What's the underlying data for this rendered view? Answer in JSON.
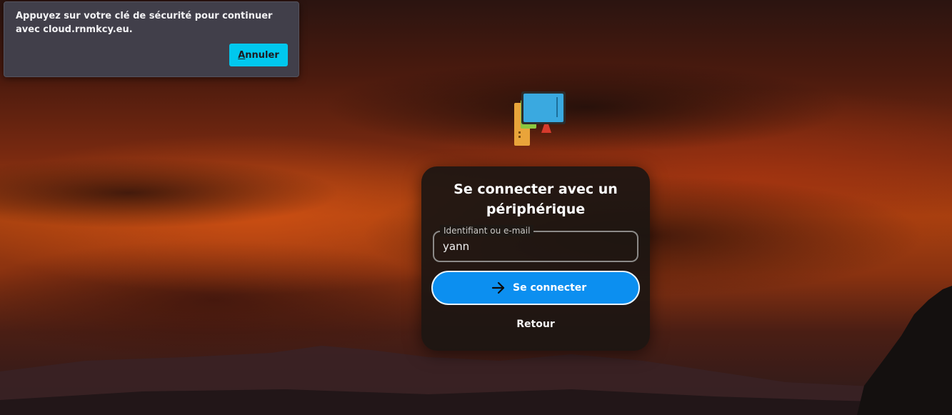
{
  "toast": {
    "message": "Appuyez sur votre clé de sécurité pour continuer avec cloud.rnmkcy.eu.",
    "cancel_accesskey": "A",
    "cancel_rest": "nnuler"
  },
  "login": {
    "title": "Se connecter avec un périphérique",
    "username_label": "Identifiant ou e-mail",
    "username_value": "yann",
    "submit_label": "Se connecter",
    "back_label": "Retour"
  },
  "icons": {
    "logo": "computer-devices-icon",
    "submit": "arrow-right-icon"
  },
  "colors": {
    "toast_button": "#00c8ee",
    "primary_button": "#0c8ff0",
    "card_background": "#1c1612"
  }
}
